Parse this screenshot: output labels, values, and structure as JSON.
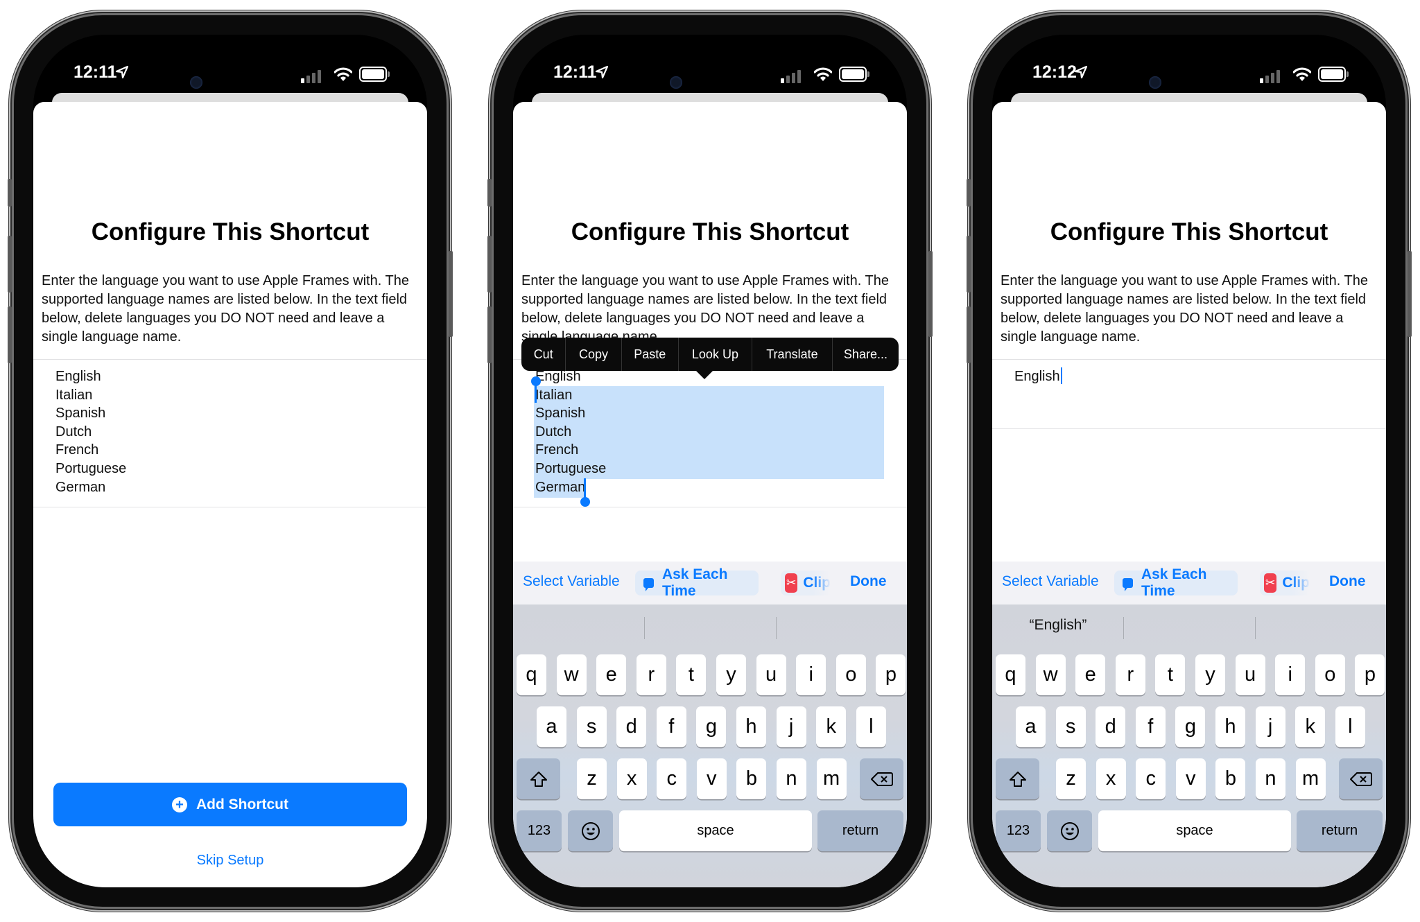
{
  "phones": [
    {
      "status": {
        "time": "12:11"
      },
      "title": "Configure This Shortcut",
      "description": "Enter the language you want to use Apple Frames with. The supported language names are listed below. In the text field below, delete languages you DO NOT need and leave a single language name.",
      "field_lines": [
        "English",
        "Italian",
        "Spanish",
        "Dutch",
        "French",
        "Portuguese",
        "German"
      ],
      "add_button": "Add Shortcut",
      "skip_link": "Skip Setup"
    },
    {
      "status": {
        "time": "12:11"
      },
      "title": "Configure This Shortcut",
      "description": "Enter the language you want to use Apple Frames with. The supported language names are listed below. In the text field below, delete languages you DO NOT need and leave a single language name.",
      "field_lines": [
        "English",
        "Italian",
        "Spanish",
        "Dutch",
        "French",
        "Portuguese",
        "German"
      ],
      "selected_text": "Italian Spanish Dutch French Portuguese German",
      "context_menu": [
        "Cut",
        "Copy",
        "Paste",
        "Look Up",
        "Translate",
        "Share..."
      ],
      "toolbar": {
        "select_variable": "Select Variable",
        "ask_each_time": "Ask Each Time",
        "clipboard": "Clip",
        "done": "Done"
      },
      "suggestions": [
        "",
        "",
        ""
      ]
    },
    {
      "status": {
        "time": "12:12"
      },
      "title": "Configure This Shortcut",
      "description": "Enter the language you want to use Apple Frames with. The supported language names are listed below. In the text field below, delete languages you DO NOT need and leave a single language name.",
      "field_lines": [
        "English"
      ],
      "toolbar": {
        "select_variable": "Select Variable",
        "ask_each_time": "Ask Each Time",
        "clipboard": "Clip",
        "done": "Done"
      },
      "suggestions": [
        "“English”",
        "",
        ""
      ]
    }
  ],
  "keyboard": {
    "row1": [
      "q",
      "w",
      "e",
      "r",
      "t",
      "y",
      "u",
      "i",
      "o",
      "p"
    ],
    "row2": [
      "a",
      "s",
      "d",
      "f",
      "g",
      "h",
      "j",
      "k",
      "l"
    ],
    "row3": [
      "z",
      "x",
      "c",
      "v",
      "b",
      "n",
      "m"
    ],
    "numbers": "123",
    "space": "space",
    "return": "return"
  },
  "icons": {
    "location": "location-arrow-icon",
    "signal": "cellular-signal-icon",
    "wifi": "wifi-icon",
    "battery": "battery-icon",
    "plus": "plus-circle-icon",
    "shift": "shift-icon",
    "delete": "delete-backspace-icon",
    "emoji": "emoji-icon",
    "globe": "globe-icon",
    "mic": "microphone-icon",
    "ask": "speech-bubble-icon",
    "clipboard": "scissors-icon"
  },
  "colors": {
    "accent": "#0a7aff",
    "selection": "#c8e1fb",
    "clip_red": "#f0404f"
  }
}
